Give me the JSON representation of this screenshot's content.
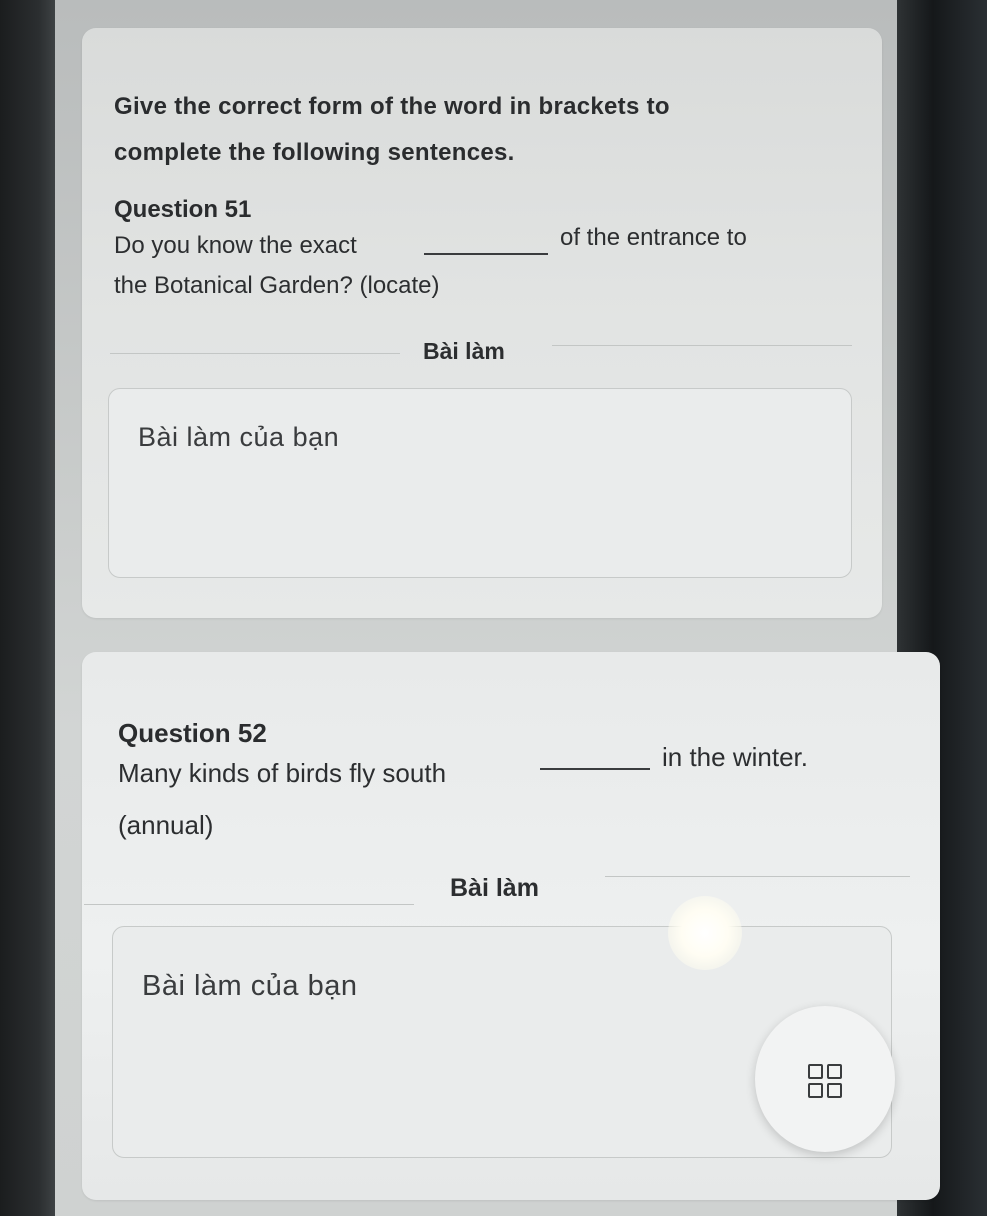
{
  "instruction": "Give the correct form of the word in brackets to complete the following sentences.",
  "questions": [
    {
      "title": "Question 51",
      "line1_before": "Do you know the exact",
      "line1_after": "of the entrance to",
      "line2": "the Botanical Garden? (locate)",
      "answer_section_label": "Bài làm",
      "answer_placeholder": "Bài làm của bạn"
    },
    {
      "title": "Question 52",
      "line1_before": "Many kinds of birds fly south",
      "line1_after": "in the winter.",
      "line2": "(annual)",
      "answer_section_label": "Bài làm",
      "answer_placeholder": "Bài làm của bạn"
    }
  ],
  "fab": {
    "icon": "grid-icon"
  }
}
